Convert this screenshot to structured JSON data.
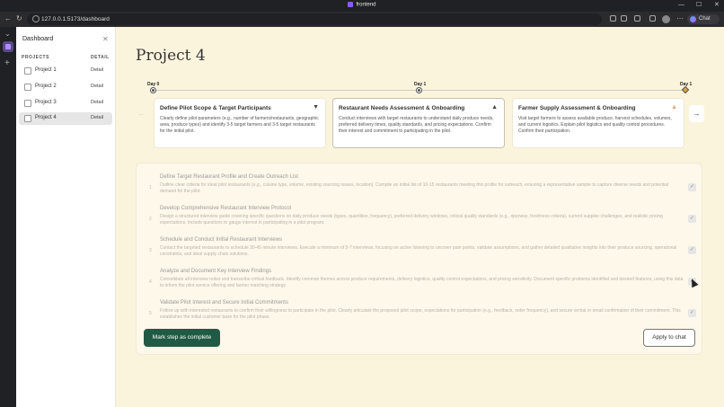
{
  "browser": {
    "window_title": "frontend",
    "url": "127.0.0.1:5173/dashboard",
    "chat_label": "Chat"
  },
  "sidebar": {
    "title": "Dashboard",
    "col_projects": "PROJECTS",
    "col_detail": "DETAIL",
    "items": [
      {
        "name": "Project 1",
        "detail": "Detail"
      },
      {
        "name": "Project 2",
        "detail": "Detail"
      },
      {
        "name": "Project 3",
        "detail": "Detail"
      },
      {
        "name": "Project 4",
        "detail": "Detail"
      }
    ]
  },
  "project": {
    "title": "Project 4"
  },
  "timeline": {
    "labels": [
      "Day 0",
      "Day 1",
      "Day 1"
    ]
  },
  "steps": [
    {
      "title": "Define Pilot Scope & Target Participants",
      "description": "Clearly define pilot parameters (e.g., number of farmers/restaurants, geographic area, produce types) and identify 3-5 target farmers and 3-5 target restaurants for the initial pilot.",
      "icon": "triangle-down-icon"
    },
    {
      "title": "Restaurant Needs Assessment & Onboarding",
      "description": "Conduct interviews with target restaurants to understand daily produce needs, preferred delivery times, quality standards, and pricing expectations. Confirm their interest and commitment to participating in the pilot.",
      "icon": "triangle-up-icon"
    },
    {
      "title": "Farmer Supply Assessment & Onboarding",
      "description": "Visit target farmers to assess available produce, harvest schedules, volumes, and current logistics. Explain pilot logistics and quality control procedures. Confirm their participation.",
      "icon": "warning-icon"
    }
  ],
  "tasks": [
    {
      "num": "1",
      "title": "Define Target Restaurant Profile and Create Outreach List",
      "description": "Outline clear criteria for ideal pilot restaurants (e.g., cuisine type, volume, existing sourcing issues, location). Compile an initial list of 10-15 restaurants meeting this profile for outreach, ensuring a representative sample to capture diverse needs and potential demand for the pilot."
    },
    {
      "num": "2",
      "title": "Develop Comprehensive Restaurant Interview Protocol",
      "description": "Design a structured interview guide covering specific questions on daily produce needs (types, quantities, frequency), preferred delivery windows, critical quality standards (e.g., ripeness, freshness criteria), current supplier challenges, and realistic pricing expectations. Include questions to gauge interest in participating in a pilot program."
    },
    {
      "num": "3",
      "title": "Schedule and Conduct Initial Restaurant Interviews",
      "description": "Contact the targeted restaurants to schedule 30-45 minute interviews. Execute a minimum of 5-7 interviews, focusing on active listening to uncover pain points, validate assumptions, and gather detailed qualitative insights into their produce sourcing, operational constraints, and ideal supply chain solutions."
    },
    {
      "num": "4",
      "title": "Analyze and Document Key Interview Findings",
      "description": "Consolidate all interview notes and transcribe critical feedback. Identify common themes across produce requirements, delivery logistics, quality control expectations, and pricing sensitivity. Document specific problems identified and desired features, using this data to inform the pilot service offering and farmer matching strategy."
    },
    {
      "num": "5",
      "title": "Validate Pilot Interest and Secure Initial Commitments",
      "description": "Follow up with interested restaurants to confirm their willingness to participate in the pilot. Clearly articulate the proposed pilot scope, expectations for participation (e.g., feedback, order frequency), and secure verbal or email confirmation of their commitment. This establishes the initial customer base for the pilot phase."
    }
  ],
  "actions": {
    "mark_complete": "Mark step as complete",
    "apply_chat": "Apply to chat"
  },
  "colors": {
    "background": "#fbf4dc",
    "primary": "#205a44",
    "accent_warning": "#e0a87a"
  }
}
